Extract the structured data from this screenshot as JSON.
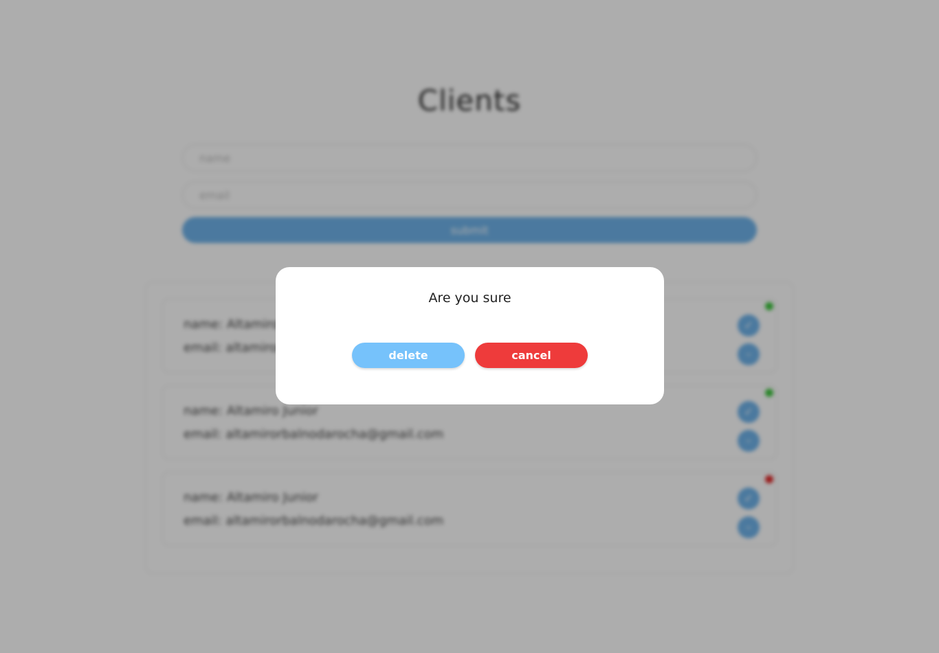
{
  "app": {
    "title": "Clients",
    "form": {
      "name_placeholder": "name",
      "email_placeholder": "email",
      "submit_label": "submit"
    },
    "clients": [
      {
        "name_line": "name: Altamiro Junior",
        "email_line": "email: altamirorbalnodarocha@gmail.com",
        "status": "active"
      },
      {
        "name_line": "name: Altamiro Junior",
        "email_line": "email: altamirorbalnodarocha@gmail.com",
        "status": "active"
      },
      {
        "name_line": "name: Altamiro Junior",
        "email_line": "email: altamirorbalnodarocha@gmail.com",
        "status": "inactive"
      }
    ]
  },
  "dialog": {
    "message": "Are you sure",
    "delete_label": "delete",
    "cancel_label": "cancel"
  },
  "colors": {
    "accent_blue": "#6fb3ea",
    "delete_blue": "#76c2fb",
    "cancel_red": "#ee3b3b",
    "status_active": "#3bc43b",
    "status_inactive": "#e02828",
    "overlay": "rgba(0,0,0,0.32)"
  },
  "icons": {
    "edit": "check-icon",
    "remove": "minus-icon"
  }
}
